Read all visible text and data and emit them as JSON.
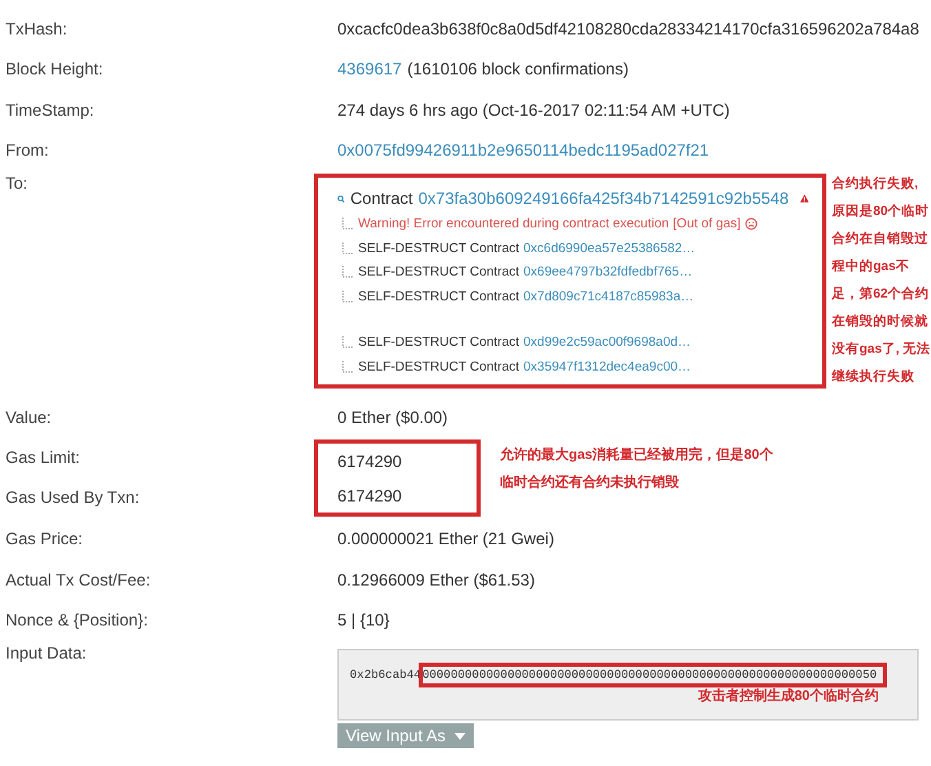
{
  "rows": [
    {
      "kind": "text",
      "label": "TxHash:",
      "value": "0xcacfc0dea3b638f0c8a0d5df42108280cda28334214170cfa316596202a784a8"
    },
    {
      "kind": "link_note",
      "label": "Block Height:",
      "link": "4369617",
      "note": "(1610106 block confirmations)"
    },
    {
      "kind": "text",
      "label": "TimeStamp:",
      "value": "274 days 6 hrs ago (Oct-16-2017 02:11:54 AM +UTC)"
    },
    {
      "kind": "link",
      "label": "From:",
      "link": "0x0075fd99426911b2e9650114bedc1195ad027f21"
    }
  ],
  "to": {
    "label": "To:",
    "prefix": "Contract",
    "address": "0x73fa30b609249166fa425f34b7142591c92b5548",
    "warning": "Warning! Error encountered during contract execution",
    "error_tag": "[Out of gas]",
    "child_groups": [
      [
        {
          "action": "SELF-DESTRUCT Contract",
          "address": "0xc6d6990ea57e25386582…"
        },
        {
          "action": "SELF-DESTRUCT Contract",
          "address": "0x69ee4797b32fdfedbf765…"
        },
        {
          "action": "SELF-DESTRUCT Contract",
          "address": "0x7d809c71c4187c85983a…"
        }
      ],
      [
        {
          "action": "SELF-DESTRUCT Contract",
          "address": "0xd99e2c59ac00f9698a0d…"
        },
        {
          "action": "SELF-DESTRUCT Contract",
          "address": "0x35947f1312dec4ea9c00…"
        }
      ]
    ],
    "annotation": "合约执行失败, 原因是80个临时合约在自销毁过程中的gas不足，第62个合约在销毁的时候就没有gas了, 无法继续执行失败"
  },
  "value": {
    "label": "Value:",
    "value": "0 Ether ($0.00)"
  },
  "gas": {
    "rows": [
      {
        "label": "Gas Limit:",
        "value": "6174290"
      },
      {
        "label": "Gas Used By Txn:",
        "value": "6174290"
      }
    ],
    "annotation": "允许的最大gas消耗量已经被用完，但是80个临时合约还有合约未执行销毁"
  },
  "rows2": [
    {
      "label": "Gas Price:",
      "value": "0.000000021 Ether (21 Gwei)"
    },
    {
      "label": "Actual Tx Cost/Fee:",
      "value": "0.12966009 Ether ($61.53)"
    },
    {
      "label": "Nonce & {Position}:",
      "value": "5 | {10}"
    }
  ],
  "input": {
    "label": "Input Data:",
    "prefix": "0x2b6cab44",
    "highlighted": "0000000000000000000000000000000000000000000000000000000000000050",
    "annotation": "攻击者控制生成80个临时合约",
    "button": "View Input As"
  }
}
